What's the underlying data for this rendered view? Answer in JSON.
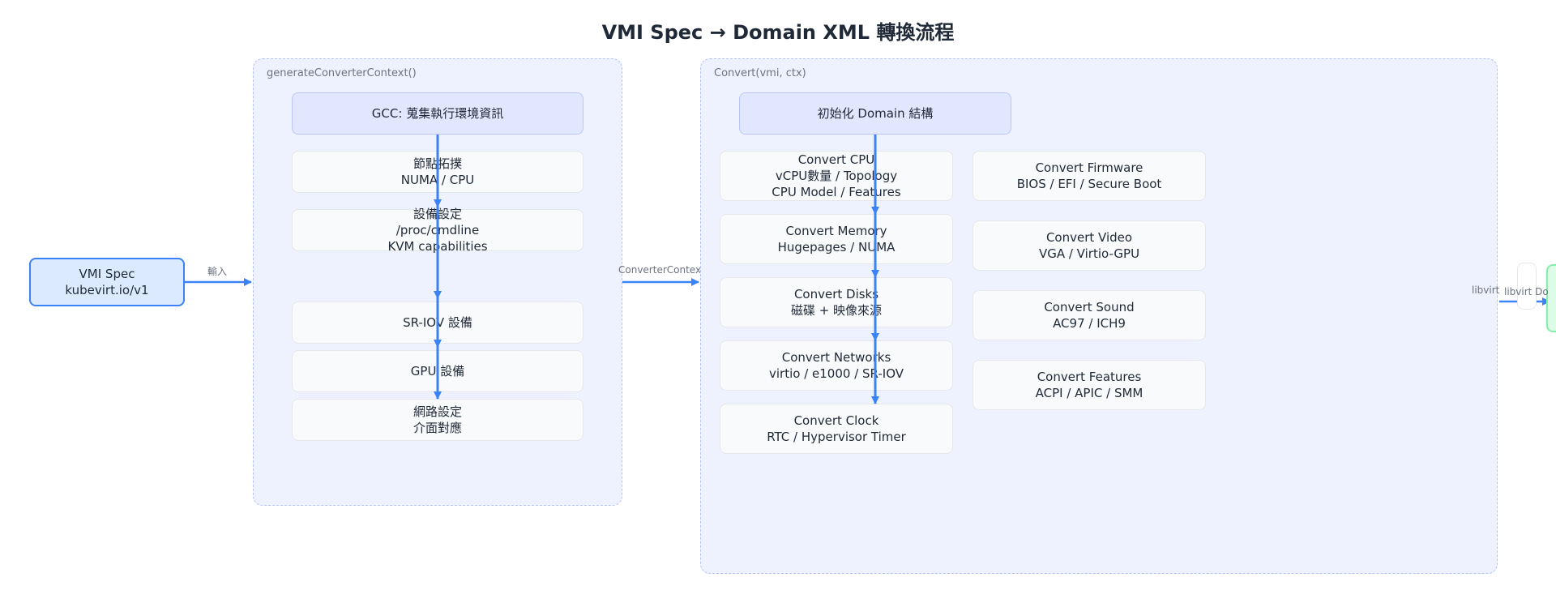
{
  "title": "VMI Spec → Domain XML 轉換流程",
  "input_node": {
    "line1": "VMI Spec",
    "line2": "kubevirt.io/v1"
  },
  "edge_labels": {
    "input": "輸入",
    "context": "ConverterContext",
    "libvirt_a": "libvirt",
    "libvirt_b": "libvirt Do"
  },
  "gcc_group": {
    "label": "generateConverterContext()",
    "header": "GCC: 蒐集執行環境資訊",
    "steps": [
      {
        "line1": "節點拓撲",
        "line2": "NUMA / CPU"
      },
      {
        "line1": "設備設定",
        "line2": "/proc/cmdline",
        "line3": "KVM capabilities"
      },
      {
        "line1": "SR-IOV 設備"
      },
      {
        "line1": "GPU 設備"
      },
      {
        "line1": "網路設定",
        "line2": "介面對應"
      }
    ]
  },
  "convert_group": {
    "label": "Convert(vmi, ctx)",
    "header": "初始化 Domain 結構",
    "left_steps": [
      {
        "line1": "Convert CPU",
        "line2": "vCPU數量 / Topology",
        "line3": "CPU Model / Features"
      },
      {
        "line1": "Convert Memory",
        "line2": "Hugepages / NUMA"
      },
      {
        "line1": "Convert Disks",
        "line2": "磁碟 + 映像來源"
      },
      {
        "line1": "Convert Networks",
        "line2": "virtio / e1000 / SR-IOV"
      },
      {
        "line1": "Convert Clock",
        "line2": "RTC / Hypervisor Timer"
      }
    ],
    "right_steps": [
      {
        "line1": "Convert Firmware",
        "line2": "BIOS / EFI / Secure Boot"
      },
      {
        "line1": "Convert Video",
        "line2": "VGA / Virtio-GPU"
      },
      {
        "line1": "Convert Sound",
        "line2": "AC97 / ICH9"
      },
      {
        "line1": "Convert Features",
        "line2": "ACPI / APIC / SMM"
      }
    ]
  },
  "colors": {
    "arrow": "#3b82f6",
    "group_border": "#b6c4f5",
    "group_fill": "#eef2fe"
  }
}
